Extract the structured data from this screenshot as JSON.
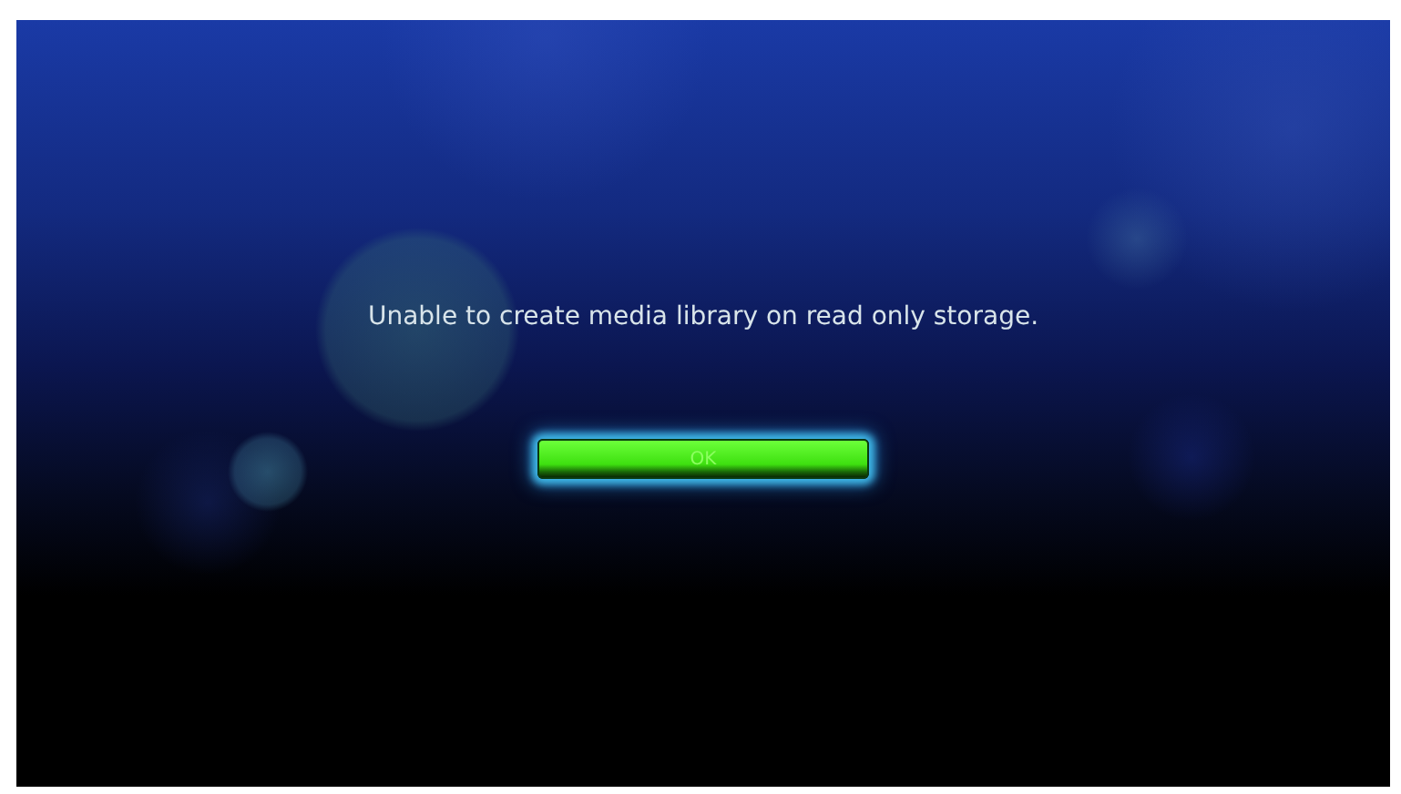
{
  "dialog": {
    "message": "Unable to create media library on read only storage.",
    "buttons": [
      {
        "label": "OK",
        "selected": true
      }
    ]
  }
}
